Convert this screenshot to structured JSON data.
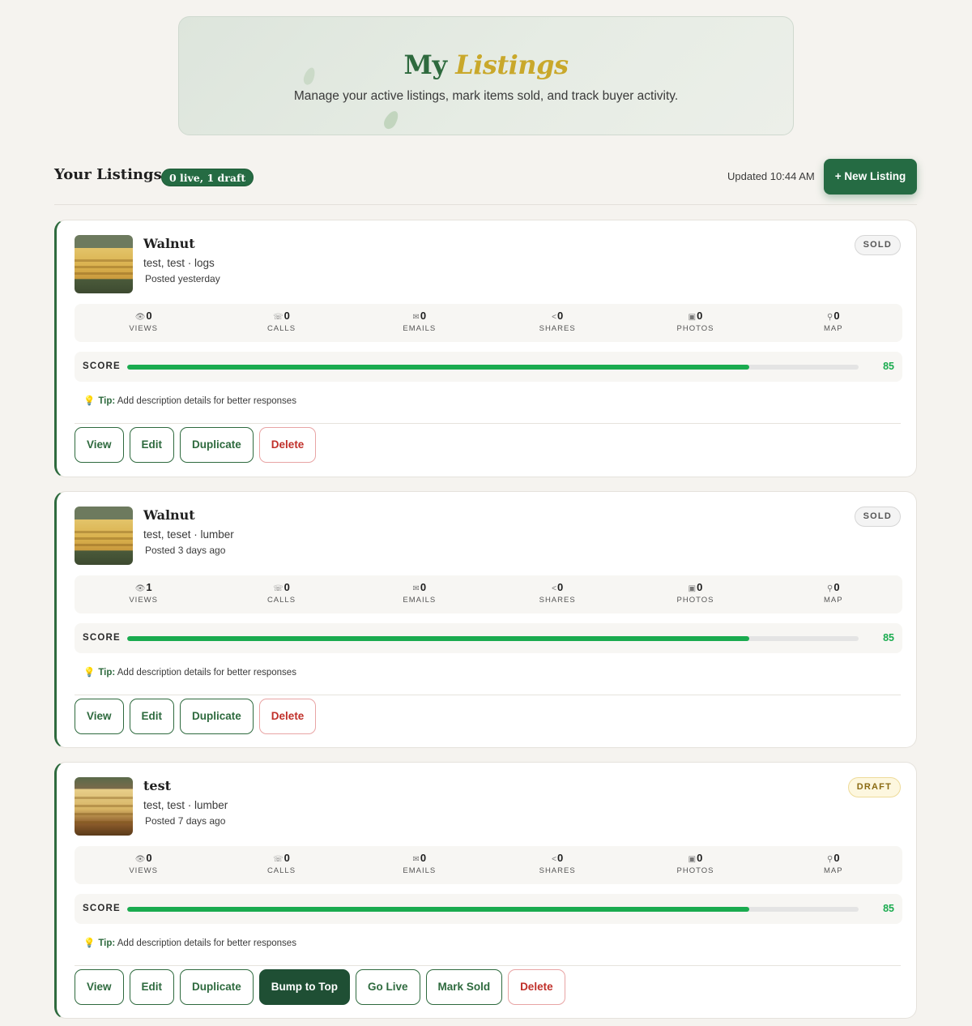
{
  "hero": {
    "title_my": "My",
    "title_listings": "Listings",
    "subtitle": "Manage your active listings, mark items sold, and track buyer activity."
  },
  "section": {
    "title": "Your Listings",
    "count_badge": "0 live, 1 draft",
    "updated": "Updated 10:44 AM",
    "new_listing_label": "+ New Listing"
  },
  "stat_labels": {
    "views": "VIEWS",
    "calls": "CALLS",
    "emails": "EMAILS",
    "shares": "SHARES",
    "photos": "PHOTOS",
    "map": "MAP"
  },
  "score_label": "SCORE",
  "tip_label": "Tip:",
  "tip_text": "Add description details for better responses",
  "colors": {
    "primary": "#256b43",
    "accent_gold": "#c9a82b",
    "score": "#1aab4f",
    "danger": "#c0302a"
  },
  "listings": [
    {
      "title": "Walnut",
      "meta": "test, test · logs",
      "posted": "Posted yesterday",
      "status": "SOLD",
      "stats": {
        "views": "0",
        "calls": "0",
        "emails": "0",
        "shares": "0",
        "photos": "0",
        "map": "0"
      },
      "score": "85",
      "actions": {
        "view": "View",
        "edit": "Edit",
        "duplicate": "Duplicate",
        "delete": "Delete"
      }
    },
    {
      "title": "Walnut",
      "meta": "test, teset · lumber",
      "posted": "Posted 3 days ago",
      "status": "SOLD",
      "stats": {
        "views": "1",
        "calls": "0",
        "emails": "0",
        "shares": "0",
        "photos": "0",
        "map": "0"
      },
      "score": "85",
      "actions": {
        "view": "View",
        "edit": "Edit",
        "duplicate": "Duplicate",
        "delete": "Delete"
      }
    },
    {
      "title": "test",
      "meta": "test, test · lumber",
      "posted": "Posted 7 days ago",
      "status": "DRAFT",
      "stats": {
        "views": "0",
        "calls": "0",
        "emails": "0",
        "shares": "0",
        "photos": "0",
        "map": "0"
      },
      "score": "85",
      "actions": {
        "view": "View",
        "edit": "Edit",
        "duplicate": "Duplicate",
        "bump": "Bump to Top",
        "go_live": "Go Live",
        "mark_sold": "Mark Sold",
        "delete": "Delete"
      }
    }
  ]
}
